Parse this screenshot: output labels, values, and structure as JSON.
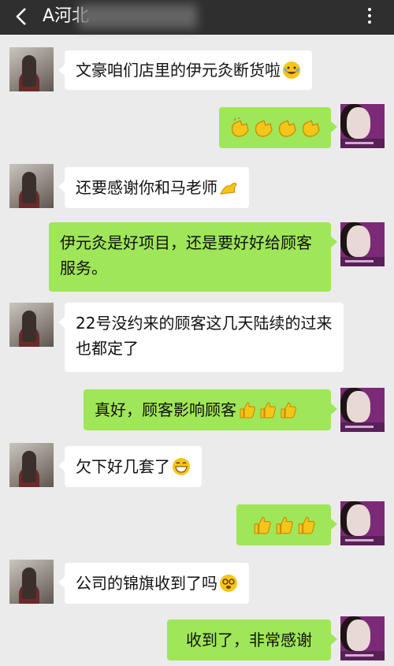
{
  "header": {
    "title": "A河北",
    "back_icon": "chevron-left-icon",
    "more_icon": "more-icon"
  },
  "messages": [
    {
      "side": "in",
      "text": "文豪咱们店里的伊元灸断货啦",
      "emoji": [
        "crying-laughing-emoji"
      ]
    },
    {
      "side": "out",
      "text": "",
      "emoji": [
        "clap-emoji",
        "clap-emoji",
        "clap-emoji",
        "clap-emoji"
      ]
    },
    {
      "side": "in",
      "text": "还要感谢你和马老师",
      "emoji": [
        "bow-emoji"
      ]
    },
    {
      "side": "out",
      "text": "伊元灸是好项目，还是要好好给顾客服务。",
      "emoji": []
    },
    {
      "side": "in",
      "text": "22号没约来的顾客这几天陆续的过来也都定了",
      "emoji": []
    },
    {
      "side": "out",
      "text": "真好，顾客影响顾客",
      "emoji": [
        "thumbs-up-emoji",
        "thumbs-up-emoji",
        "thumbs-up-emoji"
      ]
    },
    {
      "side": "in",
      "text": "欠下好几套了",
      "emoji": [
        "grin-emoji"
      ]
    },
    {
      "side": "out",
      "text": "",
      "emoji": [
        "thumbs-up-emoji",
        "thumbs-up-emoji",
        "thumbs-up-emoji"
      ]
    },
    {
      "side": "in",
      "text": "公司的锦旗收到了吗",
      "emoji": [
        "dizzy-emoji"
      ]
    },
    {
      "side": "out",
      "text": "收到了，非常感谢",
      "emoji": []
    }
  ],
  "colors": {
    "header_bg": "#2f2f2f",
    "chat_bg": "#ebebeb",
    "incoming_bubble": "#ffffff",
    "outgoing_bubble": "#9fe658",
    "emoji_yellow": "#f5c518"
  }
}
